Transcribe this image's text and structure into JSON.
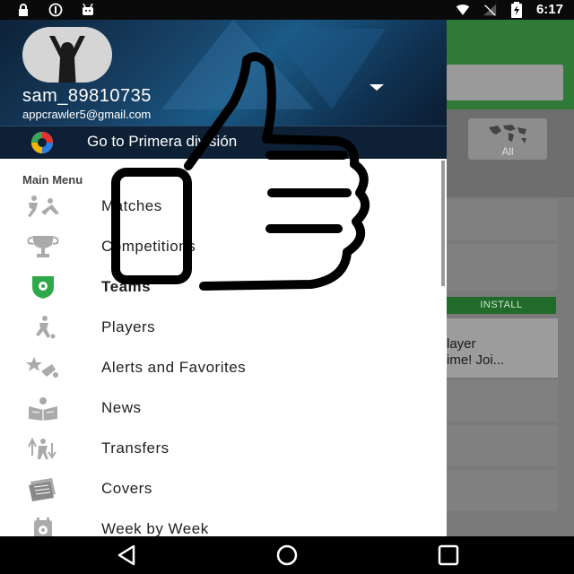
{
  "status": {
    "time": "6:17",
    "left_icons": [
      "lock-icon",
      "alert-icon",
      "android-icon"
    ],
    "right_icons": [
      "wifi-icon",
      "no-signal-icon",
      "battery-charging-icon"
    ]
  },
  "drawer": {
    "username": "sam_89810735",
    "email": "appcrawler5@gmail.com",
    "league_link": "Go to Primera división",
    "section_label": "Main Menu",
    "items": [
      {
        "label": "Matches",
        "icon": "players-tackle-icon"
      },
      {
        "label": "Competitions",
        "icon": "trophy-icon"
      },
      {
        "label": "Teams",
        "icon": "shield-ball-icon"
      },
      {
        "label": "Players",
        "icon": "player-kick-icon"
      },
      {
        "label": "Alerts and Favorites",
        "icon": "star-ball-icon"
      },
      {
        "label": "News",
        "icon": "newspaper-icon"
      },
      {
        "label": "Transfers",
        "icon": "transfer-icon"
      },
      {
        "label": "Covers",
        "icon": "covers-icon"
      },
      {
        "label": "Week by Week",
        "icon": "calendar-ball-icon"
      }
    ]
  },
  "background_app": {
    "filter_all": "All",
    "install_label": "INSTALL",
    "ad_line1": "layer",
    "ad_line2": "ime! Joi..."
  },
  "colors": {
    "accent_green": "#2f7a36",
    "header_blue": "#173f63",
    "drawer_bg": "#ffffff"
  }
}
